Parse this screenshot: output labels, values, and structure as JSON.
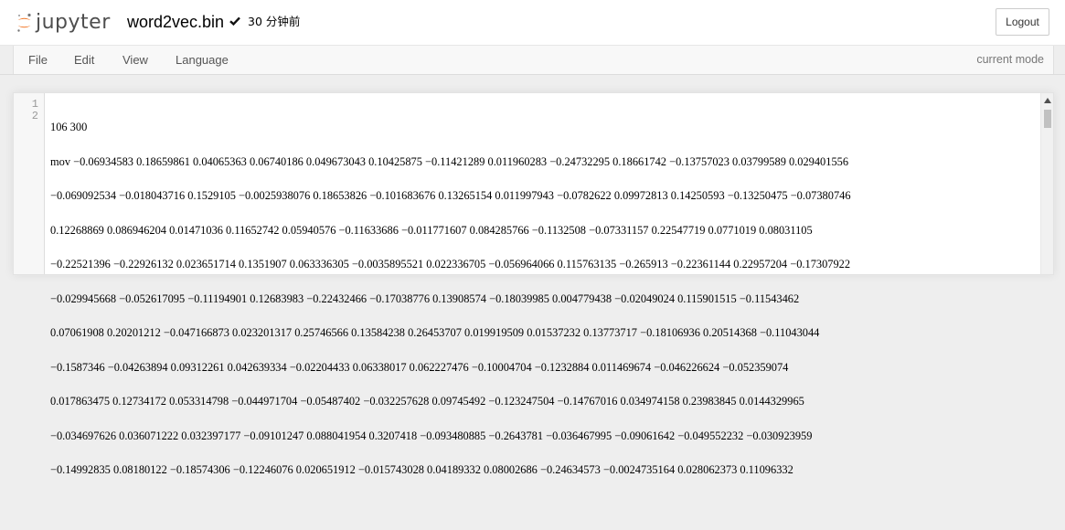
{
  "header": {
    "logo_text": "jupyter",
    "notebook_name": "word2vec.bin",
    "saved_status": "30 分钟前",
    "logout_label": "Logout"
  },
  "menubar": {
    "items": [
      "File",
      "Edit",
      "View",
      "Language"
    ],
    "mode": "current mode"
  },
  "editor": {
    "line_numbers": [
      "1",
      "2"
    ],
    "lines": [
      "106 300",
      "mov −0.06934583 0.18659861 0.04065363 0.06740186 0.049673043 0.10425875 −0.11421289 0.011960283 −0.24732295 0.18661742 −0.13757023 0.03799589 0.029401556",
      "−0.069092534 −0.018043716 0.1529105 −0.0025938076 0.18653826 −0.101683676 0.13265154 0.011997943 −0.0782622 0.09972813 0.14250593 −0.13250475 −0.07380746",
      "0.12268869 0.086946204 0.01471036 0.11652742 0.05940576 −0.11633686 −0.011771607 0.084285766 −0.1132508 −0.07331157 0.22547719 0.0771019 0.08031105",
      "−0.22521396 −0.22926132 0.023651714 0.1351907 0.063336305 −0.0035895521 0.022336705 −0.056964066 0.115763135 −0.265913 −0.22361144 0.22957204 −0.17307922",
      "−0.029945668 −0.052617095 −0.11194901 0.12683983 −0.22432466 −0.17038776 0.13908574 −0.18039985 0.004779438 −0.02049024 0.115901515 −0.11543462",
      "0.07061908 0.20201212 −0.047166873 0.023201317 0.25746566 0.13584238 0.26453707 0.019919509 0.01537232 0.13773717 −0.18106936 0.20514368 −0.11043044",
      "−0.1587346 −0.04263894 0.09312261 0.042639334 −0.02204433 0.06338017 0.062227476 −0.10004704 −0.1232884 0.011469674 −0.046226624 −0.052359074",
      "0.017863475 0.12734172 0.053314798 −0.044971704 −0.05487402 −0.032257628 0.09745492 −0.123247504 −0.14767016 0.034974158 0.23983845 0.0144329965",
      "−0.034697626 0.036071222 0.032397177 −0.09101247 0.088041954 0.3207418 −0.093480885 −0.2643781 −0.036467995 −0.09061642 −0.049552232 −0.030923959",
      "−0.14992835 0.08180122 −0.18574306 −0.12246076 0.020651912 −0.015743028 0.04189332 0.08002686 −0.24634573 −0.0024735164 0.028062373 0.11096332"
    ]
  },
  "colors": {
    "logo_orange": "#f37626",
    "logo_gray": "#767677",
    "page_bg": "#eeeeee"
  }
}
